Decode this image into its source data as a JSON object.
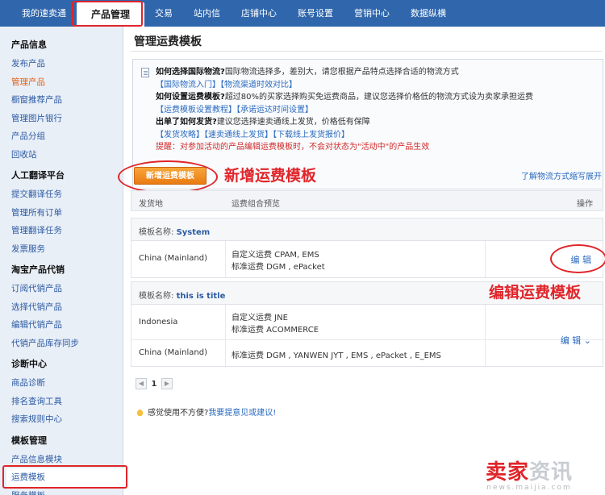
{
  "topnav": {
    "tabs": [
      "我的速卖通",
      "产品管理",
      "交易",
      "站内信",
      "店铺中心",
      "账号设置",
      "营销中心",
      "数据纵横"
    ],
    "active_index": 1
  },
  "sidebar": {
    "groups": [
      {
        "title": "产品信息",
        "items": [
          "发布产品",
          "管理产品",
          "橱窗推荐产品",
          "管理图片银行",
          "产品分组",
          "回收站"
        ]
      },
      {
        "title": "人工翻译平台",
        "items": [
          "提交翻译任务",
          "管理所有订单",
          "管理翻译任务",
          "发票服务"
        ]
      },
      {
        "title": "淘宝产品代销",
        "items": [
          "订阅代销产品",
          "选择代销产品",
          "编辑代销产品",
          "代销产品库存同步"
        ]
      },
      {
        "title": "诊断中心",
        "items": [
          "商品诊断",
          "排名查询工具",
          "搜索规则中心"
        ]
      },
      {
        "title": "模板管理",
        "items": [
          "产品信息模块",
          "运费模板",
          "服务模板"
        ]
      }
    ]
  },
  "main": {
    "title": "管理运费模板",
    "info": {
      "q1_title": "如何选择国际物流?",
      "q1_text": "国际物流选择多，差别大，请您根据产品特点选择合适的物流方式",
      "q1_links": "【国际物流入门】【物流渠道时效对比】",
      "q2_title": "如何设置运费模板?",
      "q2_text": "超过80%的买家选择购买免运费商品，建议您选择价格低的物流方式设为卖家承担运费",
      "q2_links": "【运费模板设置教程】【承诺运达时间设置】",
      "q3_title": "出单了如何发货?",
      "q3_text": "建议您选择速卖通线上发货，价格低有保障",
      "q3_links": "【发货攻略】【速卖通线上发货】【下载线上发货报价】",
      "warning": "提醒：对参加活动的产品编辑运费模板时，不会对状态为\"活动中\"的产品生效"
    },
    "add_button": "新增运费模板",
    "annotation_add": "新增运费模板",
    "link_right": "了解物流方式缩写展开",
    "table": {
      "col_origin": "发货地",
      "col_preview": "运费组合预览",
      "col_action": "操作",
      "templates": [
        {
          "label": "模板名称:",
          "name": "System",
          "rows": [
            {
              "origin": "China (Mainland)",
              "lines": [
                "自定义运费 CPAM, EMS",
                "标准运费 DGM , ePacket"
              ]
            }
          ],
          "edit": "编 辑"
        },
        {
          "label": "模板名称:",
          "name": "this is title",
          "rows": [
            {
              "origin": "Indonesia",
              "lines": [
                "自定义运费 JNE",
                "标准运费 ACOMMERCE"
              ]
            },
            {
              "origin": "China (Mainland)",
              "lines": [
                "标准运费 DGM , YANWEN JYT , EMS , ePacket , E_EMS"
              ]
            }
          ],
          "edit": "编 辑 ⌄"
        }
      ]
    },
    "annotation_edit": "编辑运费模板",
    "pager": {
      "prev": "◀",
      "page": "1",
      "next": "▶"
    },
    "feedback_text": "感觉使用不方便?",
    "feedback_link": "我要提意见或建议!"
  },
  "watermark": {
    "brand_a": "卖家",
    "brand_b": "资讯",
    "url": "news.maijia.com"
  }
}
